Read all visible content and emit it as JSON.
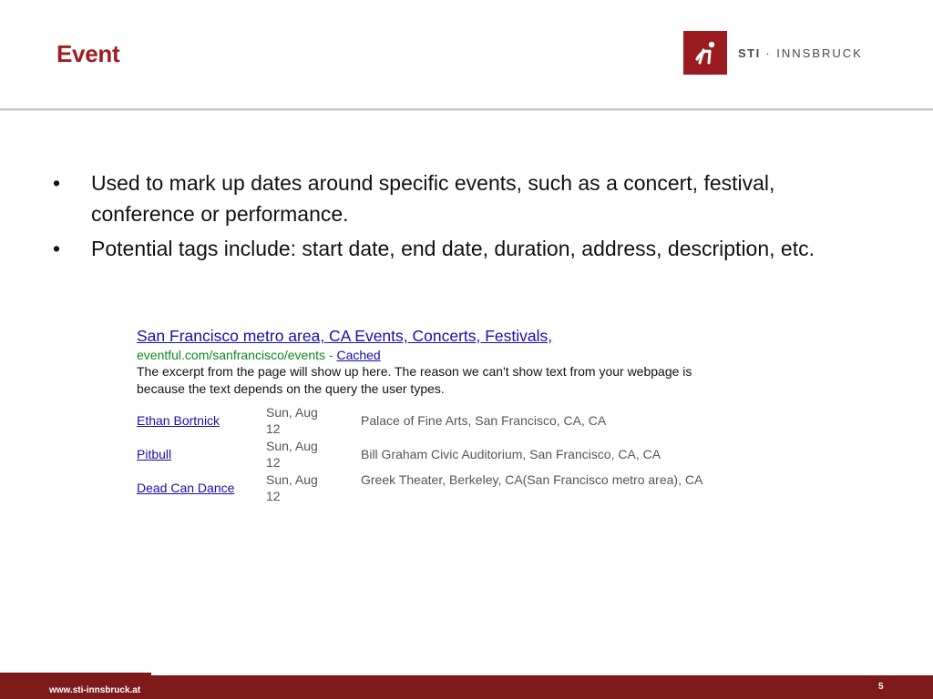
{
  "slide": {
    "title": "Event",
    "page_number": "5"
  },
  "logo": {
    "brand_bold": "STI",
    "brand_rest": " · INNSBRUCK",
    "icon": "sti-logo-icon",
    "color": "#9b1c20"
  },
  "bullets": [
    "Used to mark up dates around specific events, such as a concert, festival, conference or performance.",
    "Potential tags include: start date, end date, duration, address, description, etc."
  ],
  "bullet_glyph": "•",
  "serp": {
    "title": "San Francisco metro area, CA Events, Concerts, Festivals,",
    "url": "eventful.com/sanfrancisco/events",
    "separator": " - ",
    "cached": "Cached",
    "snippet": "The excerpt from the page will show up here. The reason we can't show text from your webpage is because the text depends on the query the user types.",
    "events": [
      {
        "name": "Ethan Bortnick",
        "date_line1": "Sun, Aug",
        "date_line2": "12",
        "venue": "Palace of Fine Arts, San Francisco, CA, CA"
      },
      {
        "name": "Pitbull",
        "date_line1": "Sun, Aug",
        "date_line2": "12",
        "venue": "Bill Graham Civic Auditorium, San Francisco, CA, CA"
      },
      {
        "name": "Dead Can Dance",
        "date_line1": "Sun, Aug",
        "date_line2": "12",
        "venue": "Greek Theater, Berkeley, CA(San Francisco metro area), CA"
      }
    ]
  },
  "footer": {
    "url": "www.sti-innsbruck.at"
  },
  "colors": {
    "accent": "#a01d21",
    "footer_bg": "#7d1b1b",
    "link": "#1a0dab",
    "url_green": "#0c8a1f"
  }
}
